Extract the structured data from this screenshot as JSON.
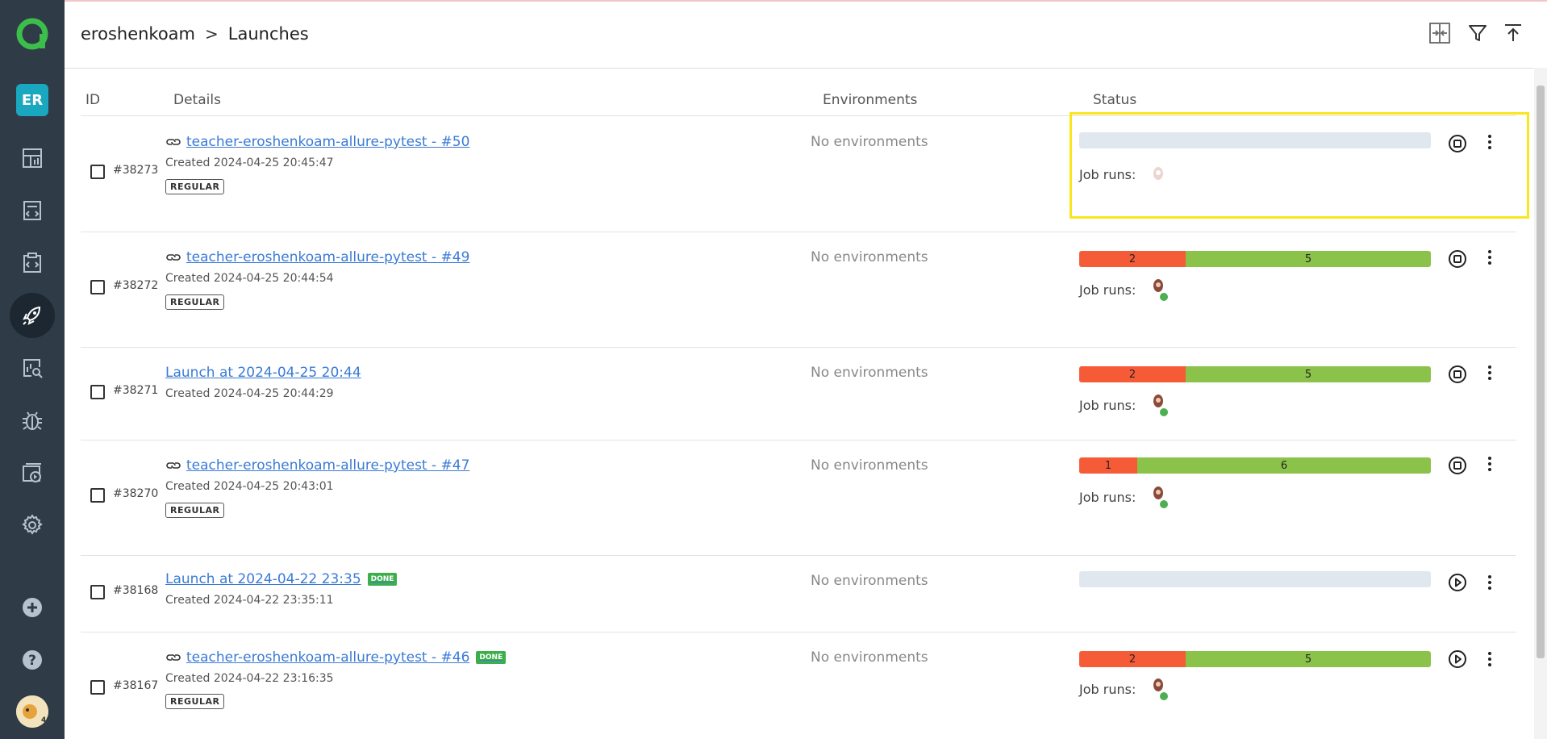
{
  "sidebar": {
    "user_initials": "ER",
    "items": [
      {
        "icon": "dashboard-icon"
      },
      {
        "icon": "test-cases-icon"
      },
      {
        "icon": "test-plans-icon"
      },
      {
        "icon": "launches-icon"
      },
      {
        "icon": "analytics-icon"
      },
      {
        "icon": "defects-icon"
      },
      {
        "icon": "jobs-icon"
      },
      {
        "icon": "settings-icon"
      }
    ]
  },
  "header": {
    "project": "eroshenkoam",
    "separator": ">",
    "page": "Launches"
  },
  "columns": {
    "id": "ID",
    "details": "Details",
    "environments": "Environments",
    "status": "Status"
  },
  "rows": [
    {
      "id": "#38273",
      "title": "teacher-eroshenkoam-allure-pytest - #50",
      "created": "Created 2024-04-25 20:45:47",
      "tag": "REGULAR",
      "env": "No environments",
      "failed": "",
      "passed": "",
      "job_runs": "Job runs:"
    },
    {
      "id": "#38272",
      "title": "teacher-eroshenkoam-allure-pytest - #49",
      "created": "Created 2024-04-25 20:44:54",
      "tag": "REGULAR",
      "env": "No environments",
      "failed": "2",
      "passed": "5",
      "job_runs": "Job runs:"
    },
    {
      "id": "#38271",
      "title": "Launch at 2024-04-25 20:44",
      "created": "Created 2024-04-25 20:44:29",
      "tag": "",
      "env": "No environments",
      "failed": "2",
      "passed": "5",
      "job_runs": "Job runs:"
    },
    {
      "id": "#38270",
      "title": "teacher-eroshenkoam-allure-pytest - #47",
      "created": "Created 2024-04-25 20:43:01",
      "tag": "REGULAR",
      "env": "No environments",
      "failed": "1",
      "passed": "6",
      "job_runs": "Job runs:"
    },
    {
      "id": "#38168",
      "title": "Launch at 2024-04-22 23:35",
      "done": "DONE",
      "created": "Created 2024-04-22 23:35:11",
      "tag": "",
      "env": "No environments",
      "failed": "",
      "passed": "",
      "job_runs": ""
    },
    {
      "id": "#38167",
      "title": "teacher-eroshenkoam-allure-pytest - #46",
      "done": "DONE",
      "created": "Created 2024-04-22 23:16:35",
      "tag": "REGULAR",
      "env": "No environments",
      "failed": "2",
      "passed": "5",
      "job_runs": "Job runs:"
    }
  ],
  "colors": {
    "failed": "#f65b38",
    "passed": "#8bc34a",
    "accent": "#3a7bd5",
    "highlight": "#f8e71c"
  }
}
